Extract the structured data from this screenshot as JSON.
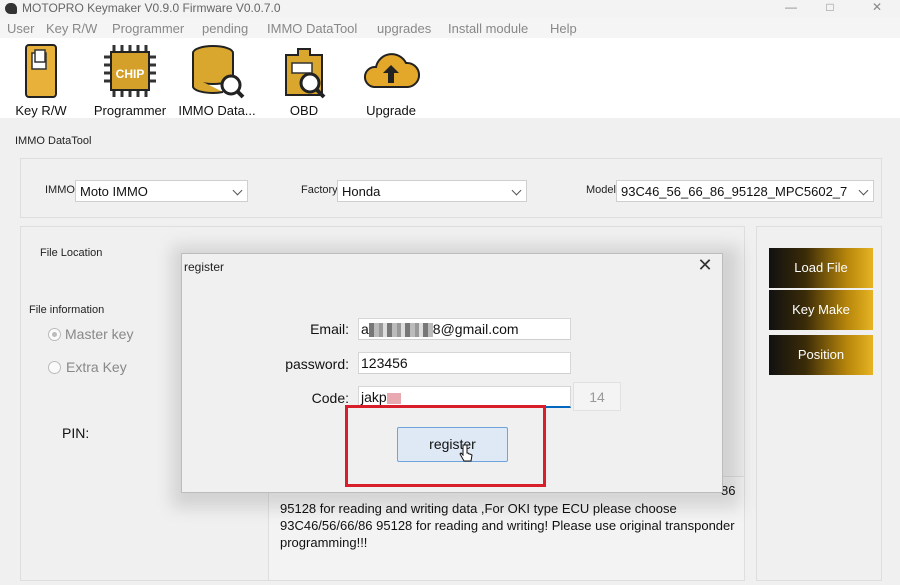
{
  "window": {
    "title": "MOTOPRO Keymaker V0.9.0 Firmware V0.0.7.0",
    "minimize": "—",
    "maximize": "□",
    "close": "✕"
  },
  "menu": [
    "User",
    "Key R/W",
    "Programmer",
    "pending",
    "IMMO DataTool",
    "upgrades",
    "Install module",
    "Help"
  ],
  "toolbar": [
    {
      "label": "Key R/W",
      "icon": "key-card-icon"
    },
    {
      "label": "Programmer",
      "icon": "chip-icon"
    },
    {
      "label": "IMMO Data...",
      "icon": "database-wrench-icon"
    },
    {
      "label": "OBD",
      "icon": "obd-scan-icon"
    },
    {
      "label": "Upgrade",
      "icon": "cloud-upload-icon"
    }
  ],
  "chip_text": "CHIP",
  "panel": {
    "title": "IMMO DataTool",
    "immo_label": "IMMO",
    "immo_value": "Moto IMMO",
    "factory_label": "Factory",
    "factory_value": "Honda",
    "model_label": "Model",
    "model_value": "93C46_56_66_86_95128_MPC5602_7",
    "file_location_label": "File Location",
    "file_information_label": "File information",
    "radio_master": "Master key",
    "radio_extra": "Extra Key",
    "pin_label": "PIN:",
    "buttons": {
      "load_file": "Load File",
      "key_make": "Key Make",
      "position": "Position"
    },
    "info_line0": "86",
    "info_text": "95128 for reading and writing data ,For OKI type ECU please choose 93C46/56/66/86 95128 for reading and writing! Please use original transponder programming!!!"
  },
  "dialog": {
    "title": "register",
    "close": "✕",
    "email_label": "Email:",
    "email_value": "a8@gmail.com",
    "email_visible_suffix": "8@gmail.com",
    "email_visible_prefix": "a",
    "password_label": "password:",
    "password_value": "123456",
    "code_label": "Code:",
    "code_value": "jakp",
    "code_count": "14",
    "register_button": "register"
  },
  "colors": {
    "accent_blue": "#0067c0",
    "highlight_red": "#d81e2a",
    "gold": "#e6b422"
  }
}
